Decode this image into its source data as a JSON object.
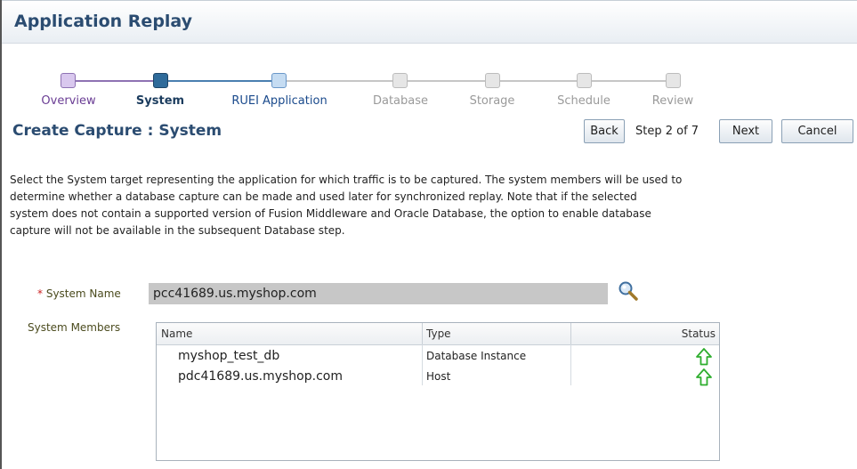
{
  "app": {
    "title": "Application Replay"
  },
  "train": {
    "stops": [
      {
        "label": "Overview",
        "state": "visited"
      },
      {
        "label": "System",
        "state": "current"
      },
      {
        "label": "RUEI Application",
        "state": "next"
      },
      {
        "label": "Database",
        "state": "future"
      },
      {
        "label": "Storage",
        "state": "future"
      },
      {
        "label": "Schedule",
        "state": "future"
      },
      {
        "label": "Review",
        "state": "future"
      }
    ]
  },
  "page": {
    "heading": "Create Capture : System",
    "back_label": "Back",
    "step_label": "Step 2 of 7",
    "next_label": "Next",
    "cancel_label": "Cancel",
    "description_lines": [
      "Select the System target representing the application for which traffic is to be captured. The system members will be used to",
      "determine whether a database capture can be made and used later for synchronized replay. Note that if the selected",
      "system does not contain a supported version of Fusion Middleware and Oracle Database, the option to enable database",
      "capture will not be available in the subsequent Database step."
    ]
  },
  "form": {
    "required_marker": "*",
    "system_name_label": "System Name",
    "system_name_value": "pcc41689.us.myshop.com",
    "system_members_label": "System Members"
  },
  "members_table": {
    "columns": [
      "Name",
      "Type",
      "Status"
    ],
    "rows": [
      {
        "name": "myshop_test_db",
        "type": "Database Instance",
        "status": "up"
      },
      {
        "name": "pdc41689.us.myshop.com",
        "type": "Host",
        "status": "up"
      }
    ]
  },
  "colors": {
    "title": "#2b4c71",
    "status_up": "#2fae2f",
    "visited": "#8e72b3",
    "current": "#2f6b9a"
  },
  "icons": {
    "search": "magnifier-icon",
    "status_up": "arrow-up-icon"
  }
}
